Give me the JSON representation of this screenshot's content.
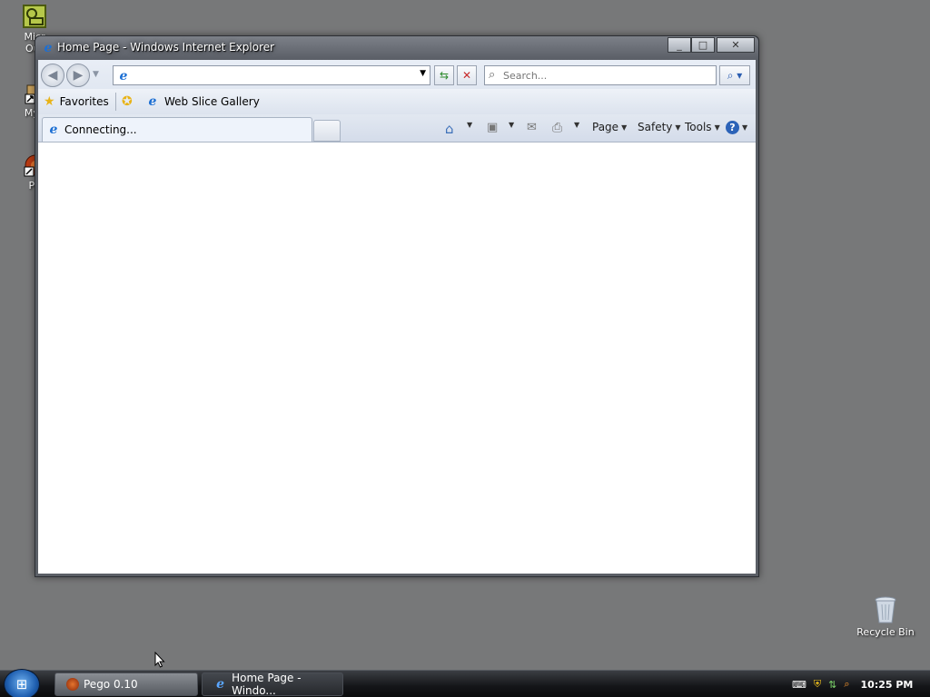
{
  "desktop": {
    "icons": [
      {
        "label": "Micr\nOut",
        "icon": "outlook-icon"
      },
      {
        "label": "MyF",
        "icon": "shortcut-icon"
      },
      {
        "label": "Pe",
        "icon": "pego-icon"
      },
      {
        "label": "Recycle Bin",
        "icon": "recycle-bin-icon"
      }
    ]
  },
  "window": {
    "title": "Home Page - Windows Internet Explorer",
    "address_value": "",
    "search_placeholder": "Search...",
    "favorites_label": "Favorites",
    "web_slice_label": "Web Slice Gallery",
    "tab_label": "Connecting...",
    "commands": {
      "page": "Page",
      "safety": "Safety",
      "tools": "Tools"
    }
  },
  "taskbar": {
    "buttons": [
      {
        "label": "Pego 0.10"
      },
      {
        "label": "Home Page - Windo..."
      }
    ],
    "clock": "10:25 PM"
  },
  "colors": {
    "desktop": "#777879",
    "taskbar": "#141518",
    "accent": "#1c6fd3"
  }
}
